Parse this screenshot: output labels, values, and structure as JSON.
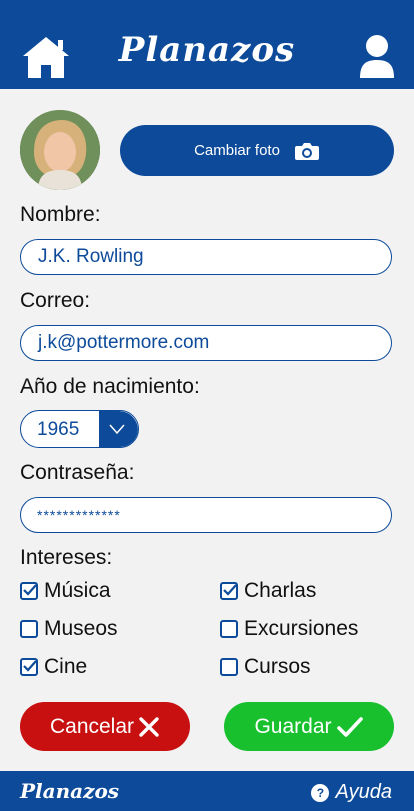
{
  "header": {
    "title": "Planazos",
    "home_icon": "home-icon",
    "user_icon": "user-icon"
  },
  "profile": {
    "change_photo_label": "Cambiar foto",
    "camera_icon": "camera-icon"
  },
  "form": {
    "name_label": "Nombre:",
    "name_value": "J.K. Rowling",
    "email_label": "Correo:",
    "email_value": "j.k@pottermore.com",
    "birth_year_label": "Año de nacimiento:",
    "birth_year_value": "1965",
    "password_label": "Contraseña:",
    "password_value": "*************"
  },
  "interests": {
    "label": "Intereses:",
    "items": [
      {
        "label": "Música",
        "checked": true
      },
      {
        "label": "Charlas",
        "checked": true
      },
      {
        "label": "Museos",
        "checked": false
      },
      {
        "label": "Excursiones",
        "checked": false
      },
      {
        "label": "Cine",
        "checked": true
      },
      {
        "label": "Cursos",
        "checked": false
      }
    ]
  },
  "actions": {
    "cancel_label": "Cancelar",
    "save_label": "Guardar"
  },
  "footer": {
    "brand": "Planazos",
    "help_label": "Ayuda",
    "help_icon_text": "?"
  },
  "colors": {
    "primary": "#0d4b9a",
    "cancel": "#c81010",
    "save": "#18c02e",
    "background": "#f2f2f2"
  }
}
